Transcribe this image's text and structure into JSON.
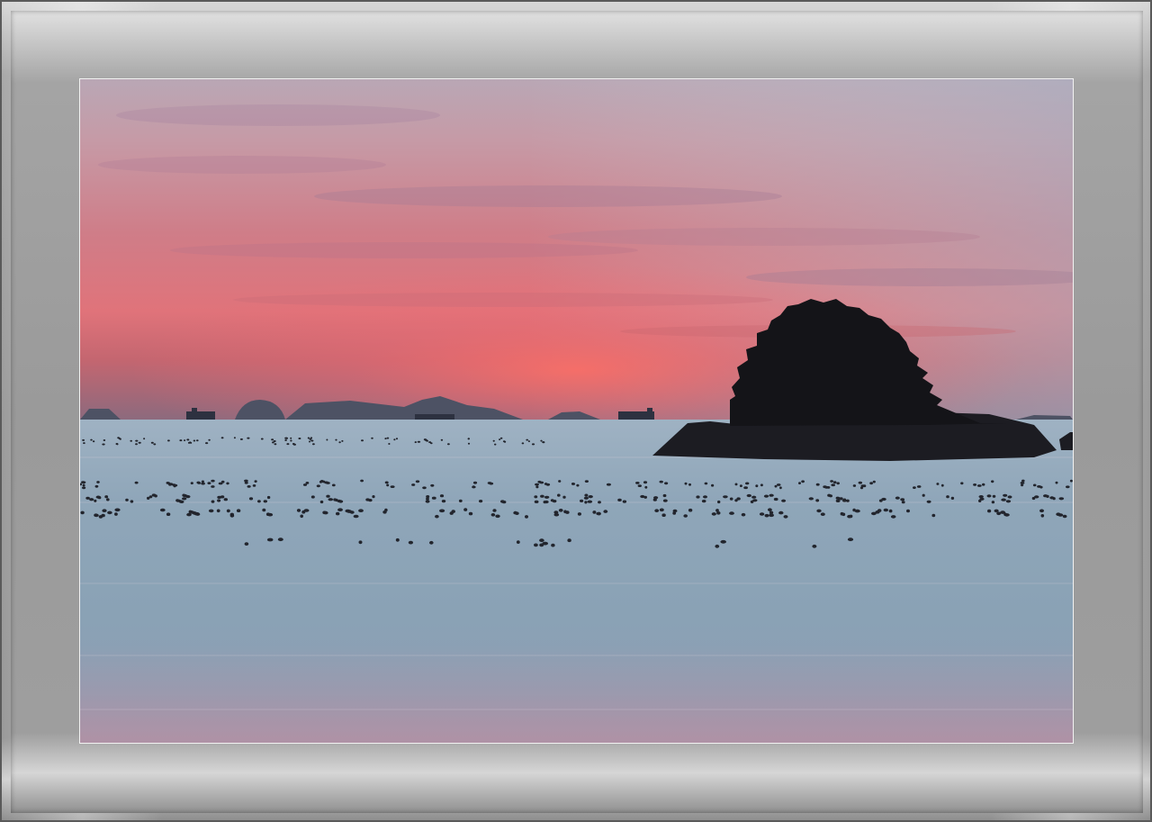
{
  "photo": {
    "subject": "sunset-seascape",
    "colors": {
      "sky_top": "#b4b7c2",
      "sky_pink": "#d87c86",
      "sky_glow": "#f0696a",
      "sea": "#8ca3b6",
      "silhouette": "#1a1a1e"
    }
  }
}
